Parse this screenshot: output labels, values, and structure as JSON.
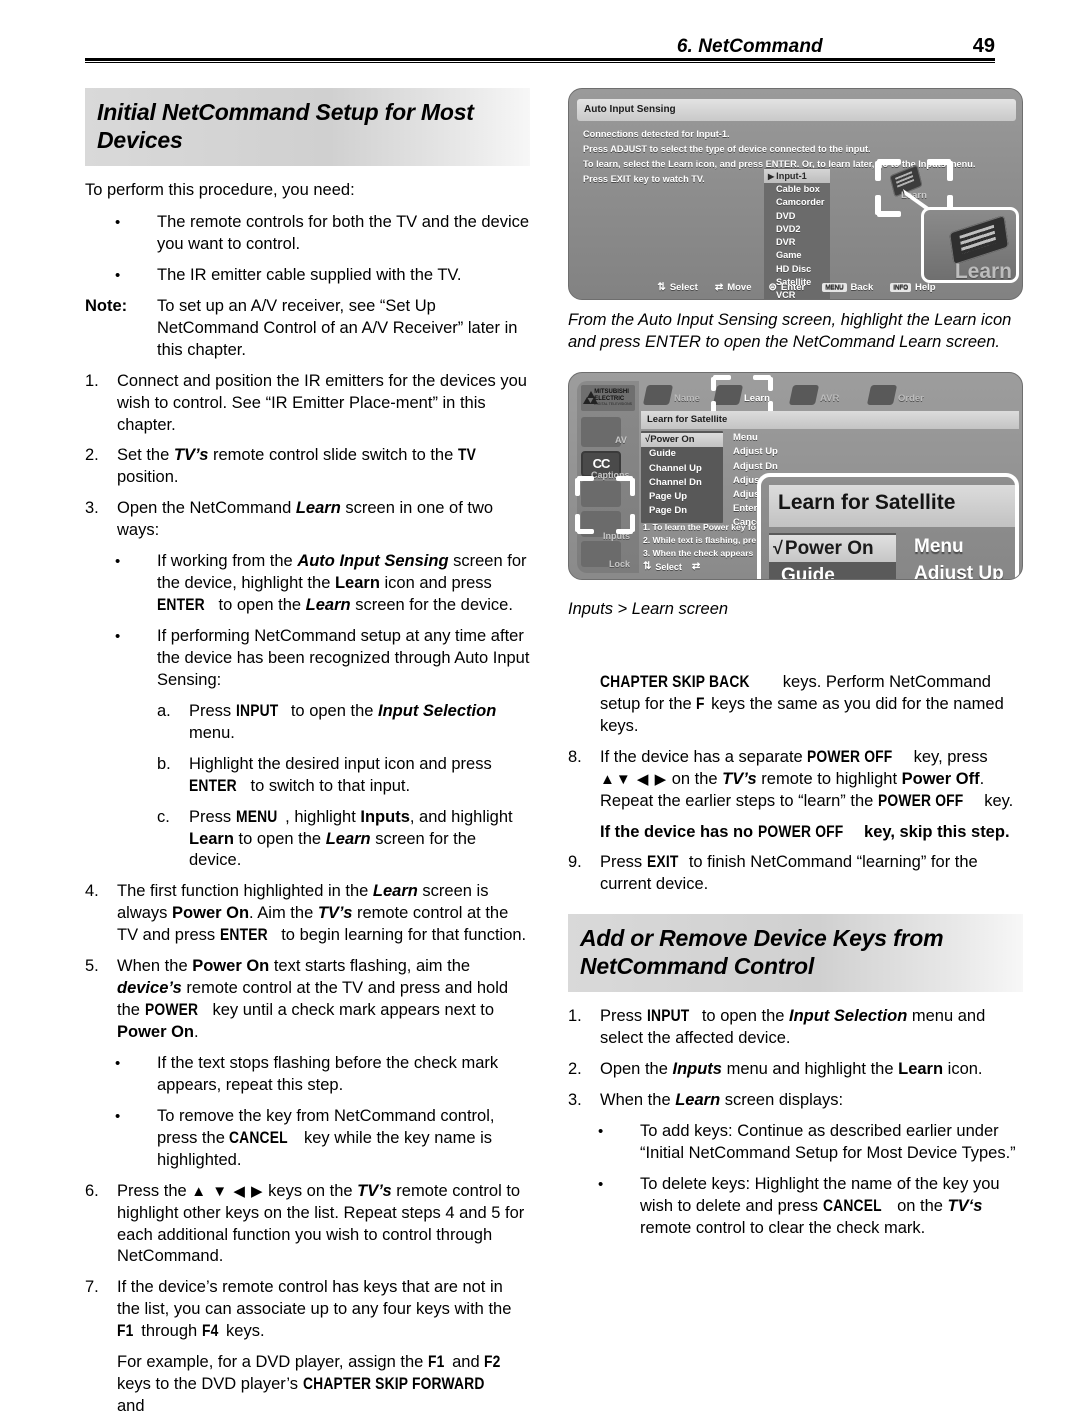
{
  "header": {
    "chapter": "6.  NetCommand",
    "page_number": "49"
  },
  "left_column": {
    "section_title": "Initial NetCommand Setup for Most Devices",
    "lead": "To perform this procedure, you need:",
    "bullets": [
      "The remote controls for both the TV and the device you want to control.",
      "The IR emitter cable supplied with the TV."
    ],
    "note_label": "Note:",
    "note_text": "To set up an A/V receiver, see “Set Up NetCommand Control of an A/V Receiver” later in this chapter.",
    "steps": {
      "n1": "1.",
      "s1": "Connect and position the IR emitters for the devices you wish to control.  See “IR Emitter Place-ment” in this chapter.",
      "n2": "2.",
      "s2_a": "Set the ",
      "s2_tv": "TV’s",
      "s2_b": " remote control slide switch to the ",
      "s2_key": "TV",
      "s2_c": " position.",
      "n3": "3.",
      "s3_a": "Open the NetCommand ",
      "s3_learn": "Learn",
      "s3_b": " screen in one of two ways:",
      "b3a_1": "If working from the ",
      "b3a_ais": "Auto Input Sensing",
      "b3a_2": " screen for the device, highlight the ",
      "b3a_learn": "Learn",
      "b3a_3": " icon and press ",
      "b3a_enter": "ENTER",
      "b3a_4": " to open the ",
      "b3a_learn2": "Learn",
      "b3a_5": " screen for the device.",
      "b3b": "If performing NetCommand setup at any time after the device has been recognized through Auto Input Sensing:",
      "la": "a.",
      "sa_1": "Press ",
      "sa_input": "INPUT",
      "sa_2": " to open the ",
      "sa_is": "Input Selection",
      "sa_3": " menu.",
      "lb": "b.",
      "sb_1": "Highlight the desired input icon and press ",
      "sb_enter": "ENTER",
      "sb_2": " to switch to that input.",
      "lc": "c.",
      "sc_1": "Press ",
      "sc_menu": "MENU",
      "sc_2": ", highlight ",
      "sc_inputs": "Inputs",
      "sc_3": ", and highlight ",
      "sc_learn": "Learn",
      "sc_4": " to open the ",
      "sc_learn2": "Learn",
      "sc_5": " screen for the device.",
      "n4": "4.",
      "s4_1": "The first function highlighted in the ",
      "s4_learn": "Learn",
      "s4_2": " screen is always ",
      "s4_poweron": "Power On",
      "s4_3": ".  Aim the ",
      "s4_tv": "TV’s",
      "s4_4": " remote control at the TV and press ",
      "s4_enter": "ENTER",
      "s4_5": " to begin learning for that function.",
      "n5": "5.",
      "s5_1": "When the ",
      "s5_poweron": "Power On",
      "s5_2": " text starts flashing, aim the ",
      "s5_dev": "device’s",
      "s5_3": " remote control at the TV and press and hold the ",
      "s5_power": "POWER",
      "s5_4": " key until a check mark appears next to ",
      "s5_poweron2": "Power On",
      "s5_5": ".",
      "b5a": "If the text stops flashing before the check mark appears, repeat this step.",
      "b5b_1": "To remove the key from NetCommand control, press the ",
      "b5b_cancel": "CANCEL",
      "b5b_2": " key while the key name is highlighted.",
      "n6": "6.",
      "s6_1": "Press the ",
      "s6_arrows": "▲ ▼ ◀  ▶",
      "s6_2": " keys on the ",
      "s6_tv": "TV’s",
      "s6_3": " remote control to highlight other keys on the list.  Repeat steps 4 and 5 for each additional function you wish to control through NetCommand.",
      "n7": "7.",
      "s7_1": "If the device’s remote control has keys that are not in the list, you can associate up to any four keys with the ",
      "s7_f1": "F1",
      "s7_2": " through ",
      "s7_f4": "F4",
      "s7_3": " keys.",
      "s7_ex_1": "For example, for a DVD player, assign the ",
      "s7_ex_f1": "F1",
      "s7_ex_2": " and ",
      "s7_ex_f2": "F2",
      "s7_ex_3": " keys to the DVD player’s ",
      "s7_ex_csf": "CHAPTER SKIP FORWARD",
      "s7_ex_4": " and"
    }
  },
  "figure_auto_input_sensing": {
    "title": "Auto Input Sensing",
    "lines": [
      "Connections detected for Input-1.",
      "Press ADJUST to select the type of device connected to the input.",
      "To learn, select the Learn icon, and press ENTER.  Or, to learn later, go to the Inputs menu.",
      "Press EXIT key to watch TV."
    ],
    "input_list": [
      "Input-1",
      "Cable box",
      "Camcorder",
      "DVD",
      "DVD2",
      "DVR",
      "Game",
      "HD Disc",
      "Satellite",
      "VCR"
    ],
    "selected_input": "Input-1",
    "learn_label": "Learn",
    "zoom_label": "Learn",
    "bottom_bar": [
      {
        "glyph": "select-icon",
        "label": "Select"
      },
      {
        "glyph": "move-icon",
        "label": "Move"
      },
      {
        "glyph": "enter-icon",
        "label": "Enter"
      },
      {
        "glyph": "MENU",
        "label": "Back"
      },
      {
        "glyph": "INFO",
        "label": "Help"
      }
    ],
    "caption": "From the Auto Input Sensing screen, highlight the Learn icon and press ENTER to open the NetCommand Learn screen."
  },
  "figure_learn_for_satellite": {
    "brand": "MITSUBISHI ELECTRIC",
    "brand_sub": "DIGITAL TELEVISIONS",
    "sidebar": [
      "AV",
      "Captions",
      "Inputs",
      "Lock"
    ],
    "nav": [
      "Name",
      "Learn",
      "AVR",
      "Order"
    ],
    "nav_active": "Learn",
    "title": "Learn for Satellite",
    "keys_left": [
      "Power On",
      "Guide",
      "Channel Up",
      "Channel Dn",
      "Page Up",
      "Page Dn"
    ],
    "keys_right": [
      "Menu",
      "Adjust Up",
      "Adjust Dn",
      "Adjust Lt",
      "Adjust Rt",
      "Enter",
      "Cancel"
    ],
    "selected_key": "Power On",
    "check_mark": "√",
    "steps": [
      "1. To learn the Power key fo",
      "2. While text is flashing, pre",
      "3. When the check appears"
    ],
    "bottom_bar": [
      {
        "glyph": "select-icon",
        "label": "Select"
      },
      {
        "glyph": "move-icon",
        "label": ""
      }
    ],
    "caption": "Inputs > Learn screen"
  },
  "right_column": {
    "cont_1": "CHAPTER SKIP BACK",
    "cont_2": " keys.  Perform NetCommand setup for the ",
    "cont_f": "F",
    "cont_3": " keys the same as you did for the named keys.",
    "n8": "8.",
    "s8_1": "If the device has a separate ",
    "s8_poweroff": "POWER OFF",
    "s8_2": " key, press ",
    "s8_arrow_up": "▲",
    "s8_arrows": "▼ ◀  ▶",
    "s8_3": " on the ",
    "s8_tv": "TV’s",
    "s8_4": " remote to highlight ",
    "s8_poweroff_b": "Power Off",
    "s8_5": ".  Repeat the earlier steps to “learn” the ",
    "s8_poweroff2": "POWER OFF",
    "s8_6": " key.",
    "s8_bold_1": "If the device has no ",
    "s8_bold_key": "POWER OFF",
    "s8_bold_2": " key, skip this step.",
    "n9": "9.",
    "s9_1": "Press ",
    "s9_exit": "EXIT",
    "s9_2": " to finish NetCommand “learning” for the current device.",
    "section_title": "Add or Remove Device Keys from NetCommand Control",
    "a1": "1.",
    "a1_1": "Press ",
    "a1_input": "INPUT",
    "a1_2": " to open the ",
    "a1_is": "Input Selection",
    "a1_3": " menu and select the affected device.",
    "a2": "2.",
    "a2_1": "Open the ",
    "a2_inputs": "Inputs",
    "a2_2": " menu and highlight the ",
    "a2_learn": "Learn",
    "a2_3": " icon.",
    "a3": "3.",
    "a3_1": "When the ",
    "a3_learn": "Learn",
    "a3_2": " screen displays:",
    "ab1": "To add keys:  Continue as described earlier under “Initial NetCommand Setup for Most Device Types.”",
    "ab2_1": "To delete keys:  Highlight the name of the key you wish to delete and press ",
    "ab2_cancel": "CANCEL",
    "ab2_2": " on the ",
    "ab2_tv": "TV‘s",
    "ab2_3": " remote control to clear the check mark."
  },
  "glyphs": {
    "bullet": "•"
  }
}
